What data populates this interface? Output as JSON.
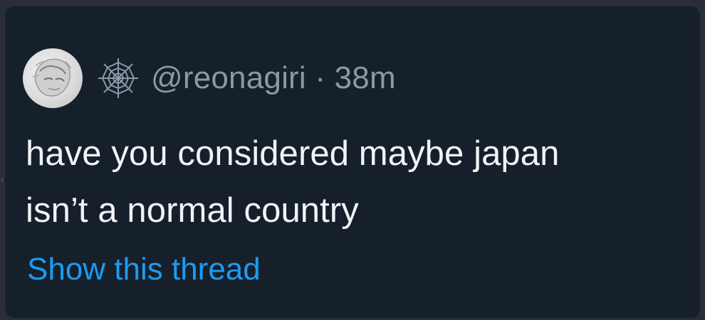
{
  "tweet": {
    "handle": "@reonagiri",
    "separator": "·",
    "time": "38m",
    "text_lines": [
      "have you considered maybe japan",
      "isn’t a normal country"
    ],
    "show_thread_label": "Show this thread",
    "name_icon": "spider-web-icon",
    "link_color": "#1d9bf0",
    "text_color": "#f1f3f5",
    "muted_color": "#8b98a5",
    "background_color": "#15202b"
  },
  "viewer": {
    "prev_arrow": "‹",
    "next_arrow": "›"
  }
}
